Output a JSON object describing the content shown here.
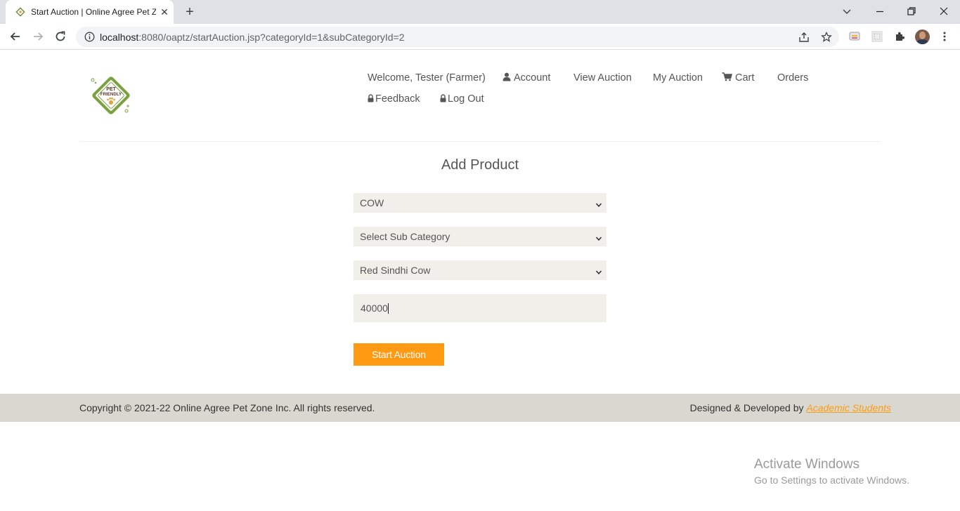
{
  "browser": {
    "tab_title": "Start Auction | Online Agree Pet Zone",
    "url_host": "localhost",
    "url_rest": ":8080/oaptz/startAuction.jsp?categoryId=1&subCategoryId=2"
  },
  "header": {
    "nav": {
      "welcome": "Welcome, Tester (Farmer)",
      "account": "Account",
      "view_auction": "View Auction",
      "my_auction": "My Auction",
      "cart": "Cart",
      "orders": "Orders",
      "feedback": "Feedback",
      "logout": "Log Out"
    },
    "logo": {
      "line1": "PET",
      "line2": "FRIENDLY"
    }
  },
  "form": {
    "title": "Add Product",
    "category_value": "COW",
    "subcategory_value": "Select Sub Category",
    "product_value": "Red Sindhi Cow",
    "price_value": "40000",
    "submit_label": "Start Auction"
  },
  "footer": {
    "copyright": "Copyright © 2021-22 Online Agree Pet Zone Inc. All rights reserved.",
    "credit_prefix": "Designed & Developed by ",
    "credit_link": "Academic Students"
  },
  "os_watermark": {
    "title": "Activate Windows",
    "subtitle": "Go to Settings to activate Windows."
  },
  "colors": {
    "accent": "#ff9a12",
    "input_bg": "#f0efe9",
    "footer_bg": "#d8d8d0"
  }
}
